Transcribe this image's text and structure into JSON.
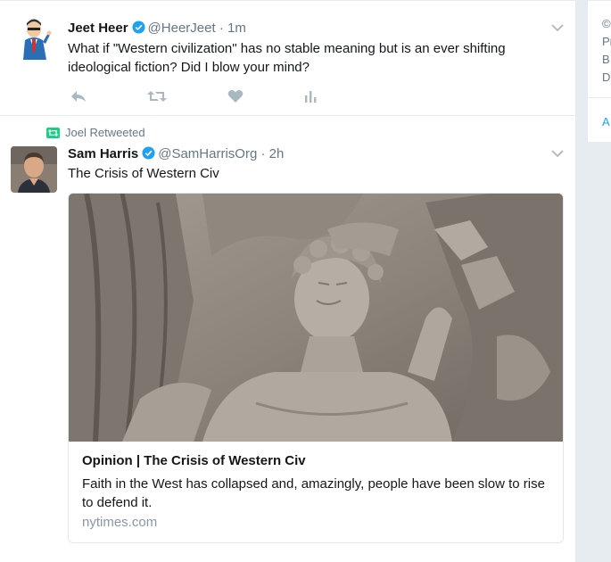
{
  "tweets": [
    {
      "fullname": "Jeet Heer",
      "username": "@HeerJeet",
      "separator": "·",
      "time": "1m",
      "text": "What if \"Western civilization\" has no stable meaning but is an ever shifting ideological fiction? Did I blow your mind?",
      "actions": [
        "reply-icon",
        "retweet-icon",
        "like-icon",
        "analytics-icon"
      ]
    },
    {
      "context": "Joel Retweeted",
      "fullname": "Sam Harris",
      "username": "@SamHarrisOrg",
      "separator": "·",
      "time": "2h",
      "text": "The Crisis of Western Civ",
      "card": {
        "title": "Opinion | The Crisis of Western Civ",
        "description": "Faith in the West has collapsed and, amazingly, people have been slow to rise to defend it.",
        "domain": "nytimes.com"
      }
    }
  ],
  "sidebar": {
    "lines": [
      "©",
      "Pr",
      "B",
      "D",
      "A"
    ]
  },
  "colors": {
    "verified": "#1da1f2",
    "retweet_green": "#19cf86",
    "muted": "#657786",
    "action_icon": "#aab8c2"
  }
}
